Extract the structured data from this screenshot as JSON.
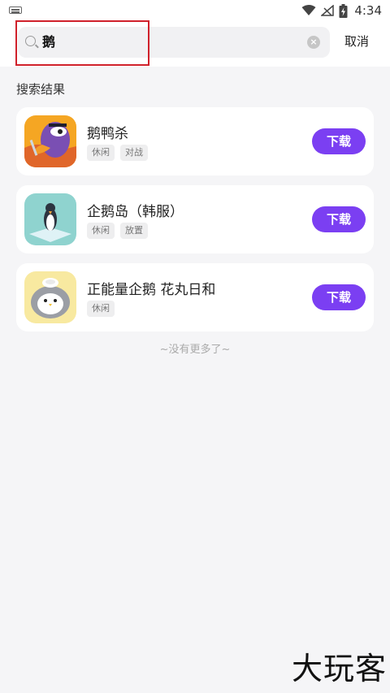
{
  "status_bar": {
    "time": "4:34"
  },
  "search": {
    "value": "鹅",
    "cancel_label": "取消"
  },
  "section_title": "搜索结果",
  "results": [
    {
      "name": "鹅鸭杀",
      "tags": [
        "休闲",
        "对战"
      ],
      "download_label": "下载"
    },
    {
      "name": "企鹅岛（韩服）",
      "tags": [
        "休闲",
        "放置"
      ],
      "download_label": "下载"
    },
    {
      "name": "正能量企鹅 花丸日和",
      "tags": [
        "休闲"
      ],
      "download_label": "下载"
    }
  ],
  "no_more_text": "~没有更多了~",
  "watermark": "大玩客",
  "colors": {
    "accent": "#7b3ff2",
    "highlight": "#d0212b"
  }
}
